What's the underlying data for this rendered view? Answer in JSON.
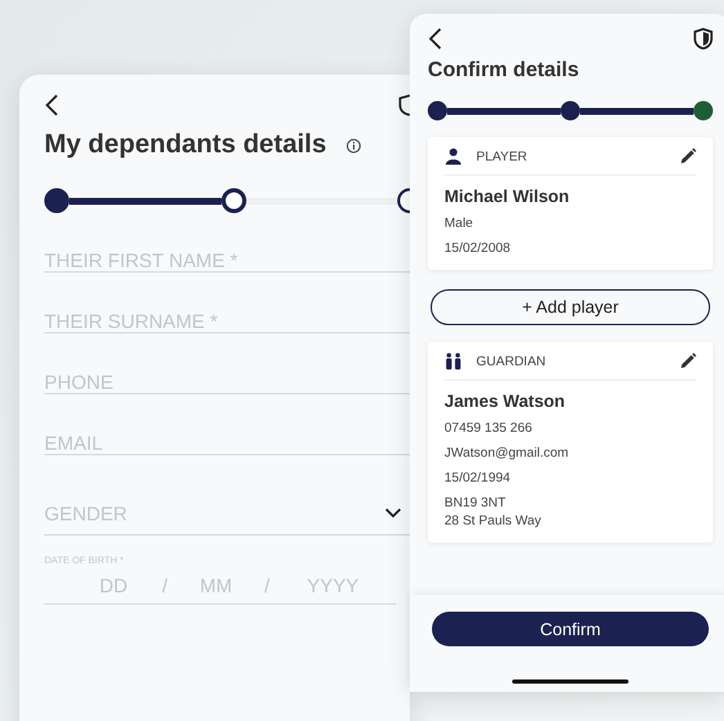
{
  "dependant_screen": {
    "title": "My dependants details",
    "steps": [
      {
        "done": true,
        "selected": false,
        "color": "#1b2150"
      },
      {
        "done": false,
        "selected": true,
        "color": "#1b2150"
      },
      {
        "done": false,
        "selected": false,
        "color": "#1b2150"
      }
    ],
    "fields": [
      {
        "kind": "text",
        "placeholder": "THEIR FIRST NAME *"
      },
      {
        "kind": "text",
        "placeholder": "THEIR SURNAME *"
      },
      {
        "kind": "text",
        "placeholder": "PHONE"
      },
      {
        "kind": "text",
        "placeholder": "EMAIL"
      },
      {
        "kind": "select",
        "placeholder": "GENDER"
      },
      {
        "kind": "date",
        "label": "DATE OF BIRTH *",
        "parts": [
          {
            "placeholder": "DD"
          },
          {
            "placeholder": "MM"
          },
          {
            "placeholder": "YYYY"
          }
        ],
        "separators": [
          "/",
          "/"
        ]
      }
    ]
  },
  "confirm_screen": {
    "title": "Confirm details",
    "steps": [
      {
        "done": true,
        "selected": false,
        "color": "#1b2150"
      },
      {
        "done": true,
        "selected": false,
        "color": "#1b2150"
      },
      {
        "done": true,
        "selected": false,
        "color": "#1e5e35"
      }
    ],
    "cards": [
      {
        "kind": "player",
        "label": "PLAYER",
        "name": "Michael Wilson",
        "lines": [
          "Male",
          "15/02/2008"
        ]
      },
      {
        "kind": "guardian",
        "label": "GUARDIAN",
        "name": "James Watson",
        "lines": [
          "07459 135 266",
          "JWatson@gmail.com",
          "15/02/1994",
          "BN19 3NT",
          "28 St Pauls Way"
        ]
      }
    ],
    "add_button": "+ Add player",
    "confirm_button": "Confirm"
  }
}
